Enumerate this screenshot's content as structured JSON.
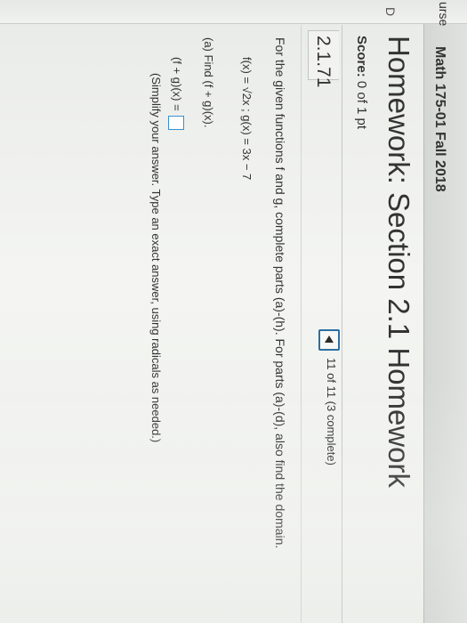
{
  "header": {
    "course_title": "Math 175-01 Fall 2018"
  },
  "left_rail": {
    "top_text": "urse",
    "mid_text": "D"
  },
  "homework": {
    "title": "Homework: Section 2.1 Homework",
    "score_label": "Score:",
    "score_value": "0 of 1 pt"
  },
  "problem": {
    "id": "2.1.71",
    "progress": "11 of 11 (3 complete)",
    "instructions": "For the given functions f and g, complete parts (a)-(h). For parts (a)-(d), also find the domain.",
    "functions": "f(x) = √2x ; g(x) = 3x − 7",
    "part_a": "(a) Find (f + g)(x).",
    "answer_label": "(f + g)(x) =",
    "hint": "(Simplify your answer. Type an exact answer, using radicals as needed.)"
  },
  "icons": {
    "prev": "left-triangle-icon"
  },
  "colors": {
    "accent": "#2d6ea3",
    "input_border": "#3a8fd0"
  }
}
